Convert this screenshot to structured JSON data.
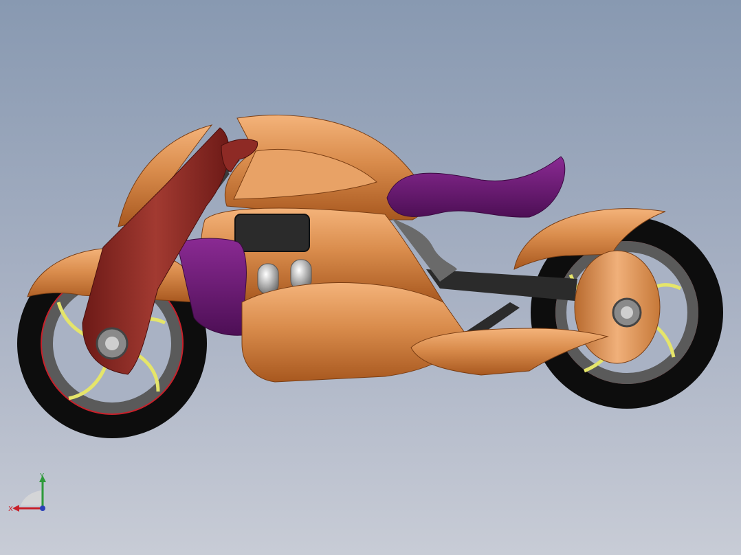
{
  "viewport": {
    "background_top": "#8899b1",
    "background_bottom": "#c8ccd6"
  },
  "model": {
    "colors": {
      "body_orange": "#d98c4c",
      "body_highlight": "#f2b27a",
      "body_shadow": "#a85a26",
      "fork_maroon": "#8e2a25",
      "seat_purple": "#6b1a72",
      "tire_black": "#0d0d0d",
      "rim_gray": "#5a5a5a",
      "rim_yellow": "#e5e56a",
      "rim_red": "#c8202a",
      "frame_dark": "#2b2b2b"
    }
  },
  "triad": {
    "x_label": "X",
    "y_label": "Y",
    "x_color": "#c8202a",
    "y_color": "#2e9a3a",
    "z_color": "#2a3fb8"
  }
}
